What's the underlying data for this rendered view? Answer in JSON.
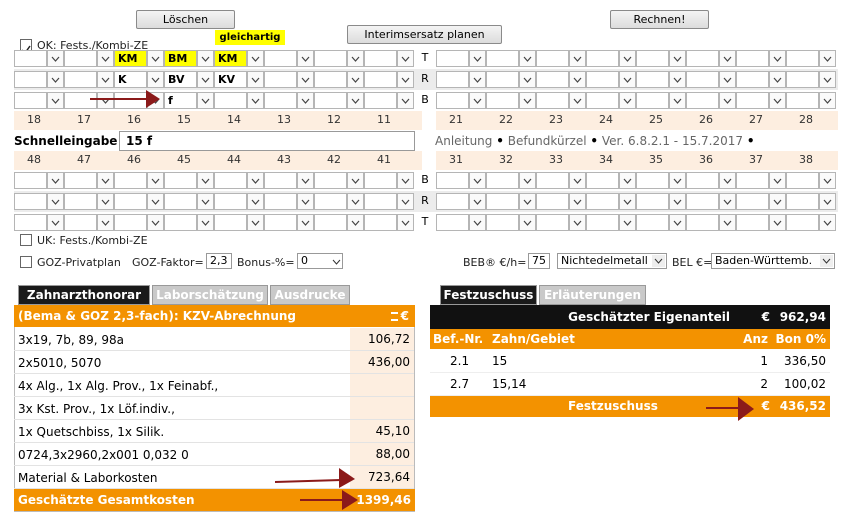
{
  "buttons": {
    "loeschen": "Löschen",
    "interim": "Interimsersatz planen",
    "rechnen": "Rechnen!"
  },
  "badge": "gleichartig",
  "ok_label": "OK: Fests./Kombi-ZE",
  "uk_label": "UK: Fests./Kombi-ZE",
  "upper_rows": [
    {
      "cells": [
        "",
        "",
        "KM",
        "BM",
        "KM",
        "",
        "",
        ""
      ],
      "side": "T"
    },
    {
      "cells": [
        "",
        "",
        "K",
        "BV",
        "KV",
        "",
        "",
        ""
      ],
      "side": "R"
    },
    {
      "cells": [
        "",
        "",
        "",
        "f",
        "",
        "",
        "",
        ""
      ],
      "side": "B"
    }
  ],
  "lower_rows": [
    {
      "side": "B"
    },
    {
      "side": "R"
    },
    {
      "side": "T"
    }
  ],
  "upper_left_teeth": [
    "18",
    "17",
    "16",
    "15",
    "14",
    "13",
    "12",
    "11"
  ],
  "upper_right_teeth": [
    "21",
    "22",
    "23",
    "24",
    "25",
    "26",
    "27",
    "28"
  ],
  "lower_left_teeth": [
    "48",
    "47",
    "46",
    "45",
    "44",
    "43",
    "42",
    "41"
  ],
  "lower_right_teeth": [
    "31",
    "32",
    "33",
    "34",
    "35",
    "36",
    "37",
    "38"
  ],
  "schnell": {
    "label": "Schnelleingabe",
    "value": "15 f"
  },
  "info": {
    "anleitung": "Anleitung",
    "befund": "Befundkürzel",
    "version": "Ver. 6.8.2.1 - 15.7.2017",
    "bullet": "•"
  },
  "options": {
    "goz_privat": "GOZ-Privatplan",
    "goz_faktor_label": "GOZ-Faktor=",
    "goz_faktor": "2,3",
    "bonus_label": "Bonus-%=",
    "bonus": "0",
    "beb_label": "BEB® €/h=",
    "beb": "75",
    "metal": "Nichtedelmetall",
    "bel_label": "BEL €=",
    "bel": "Baden-Württemb."
  },
  "left_tabs": [
    "Zahnarzthonorar",
    "Laborschätzung",
    "Ausdrucke"
  ],
  "left_header": {
    "title": "(Bema & GOZ 2,3-fach): KZV-Abrechnung",
    "currency": "€"
  },
  "left_rows": [
    {
      "text": "3x19, 7b, 89, 98a",
      "value": "106,72"
    },
    {
      "text": "2x5010, 5070",
      "value": "436,00"
    },
    {
      "text": "4x Alg., 1x Alg. Prov., 1x Feinabf.,",
      "value": ""
    },
    {
      "text": "3x Kst. Prov., 1x Löf.indiv.,",
      "value": ""
    },
    {
      "text": "1x Quetschbiss, 1x Silik.",
      "value": "45,10"
    },
    {
      "text": "0724,3x2960,2x001 0,032 0",
      "value": "88,00"
    }
  ],
  "material": {
    "label": "Material & Laborkosten",
    "value": "723,64"
  },
  "total": {
    "label": "Geschätzte Gesamtkosten",
    "value": "1399,46"
  },
  "right_tabs": [
    "Festzuschuss",
    "Erläuterungen"
  ],
  "eigenanteil": {
    "label": "Geschätzter Eigenanteil",
    "currency": "€",
    "value": "962,94"
  },
  "fz_header": {
    "befnr": "Bef.-Nr.",
    "zahn": "Zahn/Gebiet",
    "anz": "Anz",
    "bon": "Bon 0%"
  },
  "fz_rows": [
    {
      "befnr": "2.1",
      "zahn": "15",
      "anz": "1",
      "bon": "336,50"
    },
    {
      "befnr": "2.7",
      "zahn": "15,14",
      "anz": "2",
      "bon": "100,02"
    }
  ],
  "fz_total": {
    "label": "Festzuschuss",
    "currency": "€",
    "value": "436,52"
  },
  "colors": {
    "orange": "#f39200",
    "yellow": "#ffff00",
    "arrow": "#8b1a1a",
    "band": "#fdeee0"
  }
}
